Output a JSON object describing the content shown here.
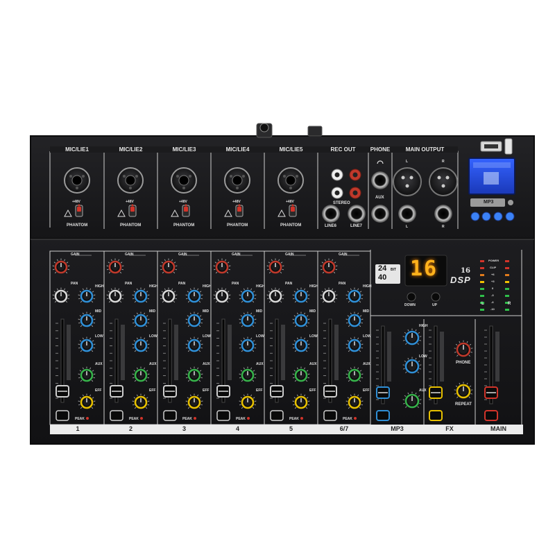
{
  "device": {
    "top_sections": {
      "inputs": [
        "MIC/LIE1",
        "MIC/LIE2",
        "MIC/LIE3",
        "MIC/LIE4",
        "MIC/LIE5"
      ],
      "rec_out": "REC OUT",
      "phone": "PHONE",
      "main_output": "MAIN OUTPUT"
    },
    "phantom_label": "PHANTOM",
    "phantom_voltage": "+48V",
    "stereo_label": "STEREO",
    "aux_label": "AUX",
    "line_inputs": [
      "LINE6",
      "LINE7"
    ],
    "xlr_left": "L",
    "xlr_right": "R",
    "mp3_badge": "MP3",
    "knob_labels": {
      "gain": "GAIN",
      "pan": "PAN",
      "high": "HIGH",
      "mid": "MID",
      "low": "LOW",
      "aux": "AUX",
      "eff": "EFF",
      "peak": "PEAK"
    },
    "channel_numbers": [
      "1",
      "2",
      "3",
      "4",
      "5",
      "6/7"
    ],
    "bus_labels": [
      "MP3",
      "FX",
      "MAIN"
    ],
    "fx_knob_labels": [
      "PHONE",
      "REPEAT"
    ],
    "dsp": {
      "display_value": "16",
      "badge_top": "24",
      "badge_bottom": "40",
      "badge_bit": "BIT",
      "preset_count": "16",
      "dsp_text": "DSP",
      "down_button": "DOWN",
      "up_button": "UP"
    },
    "meter_labels": [
      "POWER",
      "CLIP",
      "+6",
      "+3",
      "0",
      "-3",
      "-6",
      "-10"
    ],
    "meter_channels": [
      "L",
      "R"
    ],
    "colors": {
      "body": "#1b1b1d",
      "panel_line": "#cfcfcf",
      "knob_red": "#c0392b",
      "knob_blue": "#2f8fd6",
      "knob_green": "#36b24a",
      "knob_yellow": "#e7c000",
      "knob_white": "#d8d8d8",
      "display_amber": "#ffb21c",
      "lcd_blue": "#1f46c9"
    }
  }
}
